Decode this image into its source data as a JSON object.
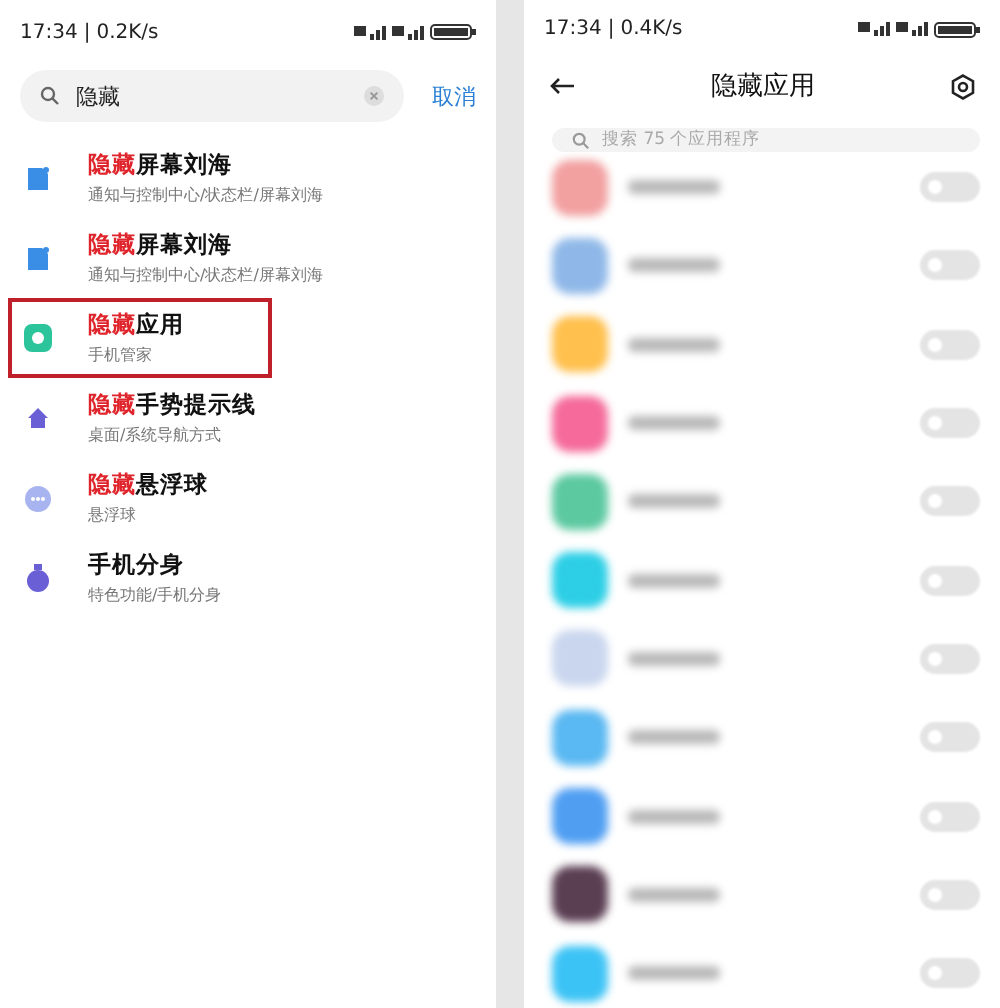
{
  "left": {
    "status_bar": {
      "time": "17:34",
      "separator": "|",
      "speed": "0.2K/s"
    },
    "search": {
      "value": "隐藏",
      "cancel": "取消"
    },
    "results": [
      {
        "highlight": "隐藏",
        "rest": "屏幕刘海",
        "path": "通知与控制中心/状态栏/屏幕刘海",
        "kind": "doc",
        "outlined": false
      },
      {
        "highlight": "隐藏",
        "rest": "屏幕刘海",
        "path": "通知与控制中心/状态栏/屏幕刘海",
        "kind": "doc",
        "outlined": false
      },
      {
        "highlight": "隐藏",
        "rest": "应用",
        "path": "手机管家",
        "kind": "shield",
        "outlined": true
      },
      {
        "highlight": "隐藏",
        "rest": "手势提示线",
        "path": "桌面/系统导航方式",
        "kind": "home",
        "outlined": false
      },
      {
        "highlight": "隐藏",
        "rest": "悬浮球",
        "path": "悬浮球",
        "kind": "dots",
        "outlined": false
      },
      {
        "rest": "手机分身",
        "path": "特色功能/手机分身",
        "kind": "clone",
        "outlined": false
      }
    ]
  },
  "right": {
    "status_bar": {
      "time": "17:34",
      "separator": "|",
      "speed": "0.4K/s"
    },
    "title": "隐藏应用",
    "search": {
      "placeholder": "搜索 75 个应用程序"
    },
    "apps": [
      {
        "color": "#f2a0a0",
        "on": false
      },
      {
        "color": "#8fb8e8",
        "on": false
      },
      {
        "color": "#ffc04d",
        "on": false
      },
      {
        "color": "#f56a9a",
        "on": false
      },
      {
        "color": "#5cc9a0",
        "on": false
      },
      {
        "color": "#2ccfe6",
        "on": false
      },
      {
        "color": "#c9d6ee",
        "on": false
      },
      {
        "color": "#5ab8f2",
        "on": false
      },
      {
        "color": "#4f9ef2",
        "on": false
      },
      {
        "color": "#5a3e52",
        "on": false
      },
      {
        "color": "#3cc3f5",
        "on": false
      }
    ]
  }
}
